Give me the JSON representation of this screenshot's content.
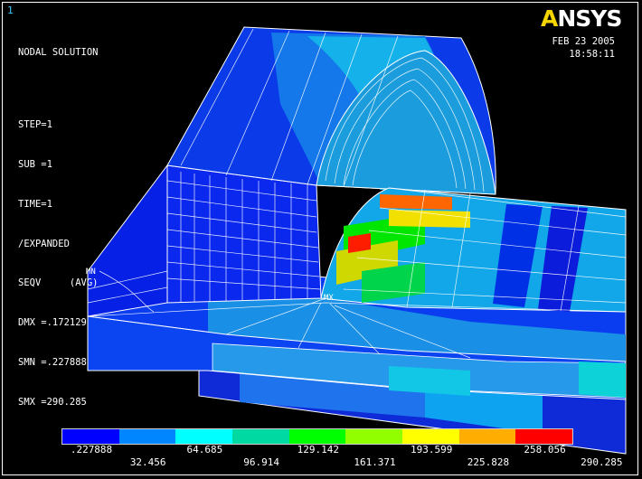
{
  "window_number": "1",
  "info_lines": {
    "title": "NODAL SOLUTION",
    "step": "STEP=1",
    "sub": "SUB =1",
    "time": "TIME=1",
    "expanded": "/EXPANDED",
    "result": "SEQV     (AVG)",
    "dmx": "DMX =.172129",
    "smn": "SMN =.227888",
    "smx": "SMX =290.285"
  },
  "brand": {
    "prefix": "A",
    "rest": "NSYS"
  },
  "date": "FEB 23 2005",
  "time": "18:58:11",
  "mn_marker": "MN",
  "mx_marker": "MX",
  "contour_colors": [
    "#0000ff",
    "#0086ff",
    "#00ffff",
    "#00d9a2",
    "#00ff00",
    "#91ff00",
    "#ffff00",
    "#ffad00",
    "#ff0000"
  ],
  "contour_labels": [
    ".227888",
    "32.456",
    "64.685",
    "96.914",
    "129.142",
    "161.371",
    "193.599",
    "225.828",
    "258.056",
    "290.285"
  ]
}
